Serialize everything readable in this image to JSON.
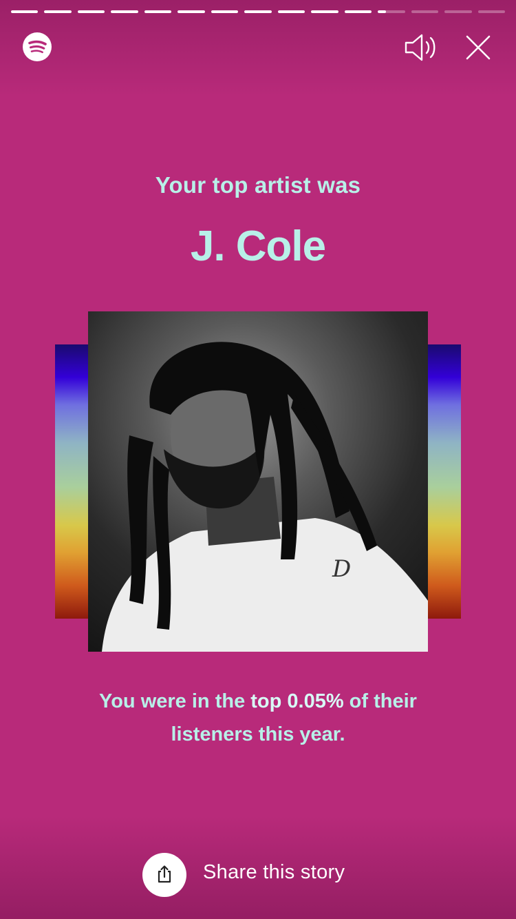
{
  "story": {
    "segments_total": 15,
    "segments_completed": 11,
    "current_segment_progress": 0.3
  },
  "header": {
    "logo_icon": "spotify-logo-icon",
    "sound_icon": "speaker-volume-icon",
    "close_icon": "close-icon"
  },
  "content": {
    "subtitle": "Your top artist was",
    "artist_name": "J. Cole",
    "photo_alt": "J. Cole",
    "stat_prefix": "You were in the ",
    "stat_highlight": "top 0.05%",
    "stat_suffix": " of their",
    "stat_line2": "listeners this year."
  },
  "footer": {
    "share_icon": "share-upload-icon",
    "share_label": "Share this story"
  },
  "colors": {
    "background": "#b82a7a",
    "accent_text": "#b8f0e8",
    "white": "#ffffff"
  }
}
